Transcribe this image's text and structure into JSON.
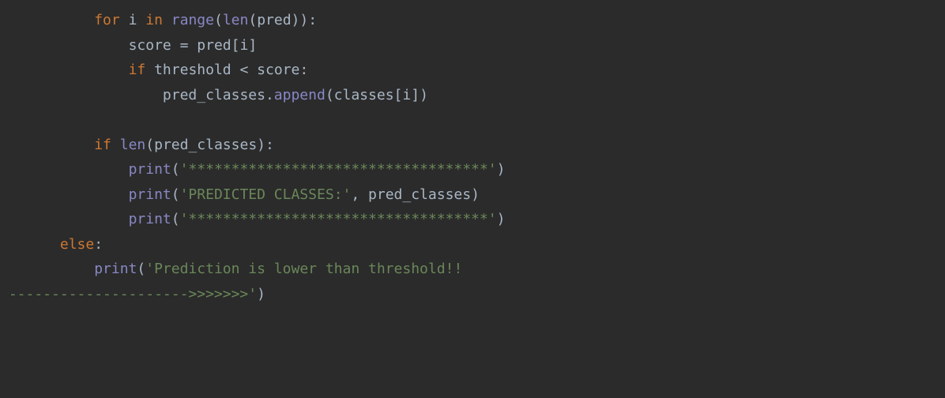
{
  "code": {
    "line1": {
      "kw_for": "for",
      "var_i": "i",
      "kw_in": "in",
      "fn_range": "range",
      "paren_open": "(",
      "fn_len": "len",
      "paren_open2": "(",
      "var_pred": "pred",
      "paren_close": "))",
      "colon": ":"
    },
    "line2": {
      "var_score": "score",
      "eq": " = ",
      "var_pred": "pred",
      "bracket_open": "[",
      "var_i": "i",
      "bracket_close": "]"
    },
    "line3": {
      "kw_if": "if",
      "var_threshold": "threshold",
      "lt": " < ",
      "var_score": "score",
      "colon": ":"
    },
    "line4": {
      "var_pc": "pred_classes",
      "dot": ".",
      "fn_append": "append",
      "paren_open": "(",
      "var_classes": "classes",
      "bracket_open": "[",
      "var_i": "i",
      "bracket_close": "]",
      "paren_close": ")"
    },
    "line6": {
      "kw_if": "if",
      "fn_len": "len",
      "paren_open": "(",
      "var_pc": "pred_classes",
      "paren_close": ")",
      "colon": ":"
    },
    "line7": {
      "fn_print": "print",
      "paren_open": "(",
      "str": "'***********************************'",
      "paren_close": ")"
    },
    "line8": {
      "fn_print": "print",
      "paren_open": "(",
      "str": "'PREDICTED CLASSES:'",
      "comma": ", ",
      "var_pc": "pred_classes",
      "paren_close": ")"
    },
    "line9": {
      "fn_print": "print",
      "paren_open": "(",
      "str": "'***********************************'",
      "paren_close": ")"
    },
    "line10": {
      "kw_else": "else",
      "colon": ":"
    },
    "line11": {
      "fn_print": "print",
      "paren_open": "(",
      "str": "'Prediction is lower than threshold!!"
    },
    "line12": {
      "str": " --------------------->>>>>>>'",
      "paren_close": ")"
    }
  }
}
